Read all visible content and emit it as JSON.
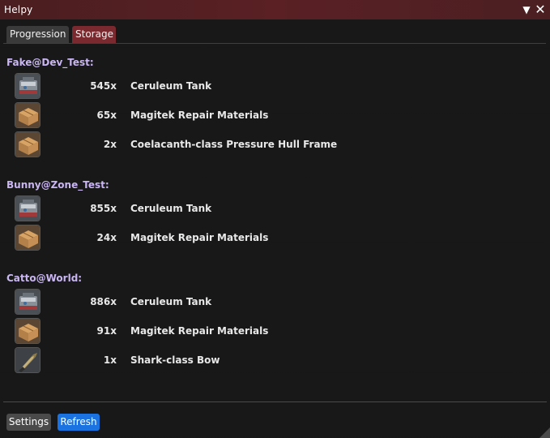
{
  "window": {
    "title": "Helpy",
    "collapse_icon": "▼",
    "close_icon": "✕"
  },
  "tabs": [
    {
      "label": "Progression",
      "active": false
    },
    {
      "label": "Storage",
      "active": true
    }
  ],
  "characters": [
    {
      "name": "Fake@Dev_Test:",
      "items": [
        {
          "qty": "545x",
          "name": "Ceruleum Tank",
          "icon": "ceruleum-tank-icon"
        },
        {
          "qty": "65x",
          "name": "Magitek Repair Materials",
          "icon": "repair-materials-icon"
        },
        {
          "qty": "2x",
          "name": "Coelacanth-class Pressure Hull Frame",
          "icon": "hull-frame-icon"
        }
      ]
    },
    {
      "name": "Bunny@Zone_Test:",
      "items": [
        {
          "qty": "855x",
          "name": "Ceruleum Tank",
          "icon": "ceruleum-tank-icon"
        },
        {
          "qty": "24x",
          "name": "Magitek Repair Materials",
          "icon": "repair-materials-icon"
        }
      ]
    },
    {
      "name": "Catto@World:",
      "items": [
        {
          "qty": "886x",
          "name": "Ceruleum Tank",
          "icon": "ceruleum-tank-icon"
        },
        {
          "qty": "91x",
          "name": "Magitek Repair Materials",
          "icon": "repair-materials-icon"
        },
        {
          "qty": "1x",
          "name": "Shark-class Bow",
          "icon": "shark-bow-icon"
        }
      ]
    }
  ],
  "footer": {
    "settings_label": "Settings",
    "refresh_label": "Refresh"
  },
  "colors": {
    "title_bar": "#5a2024",
    "active_tab": "#7a2a2f",
    "character_name": "#c9b6f2",
    "refresh_button": "#1a73e0"
  }
}
